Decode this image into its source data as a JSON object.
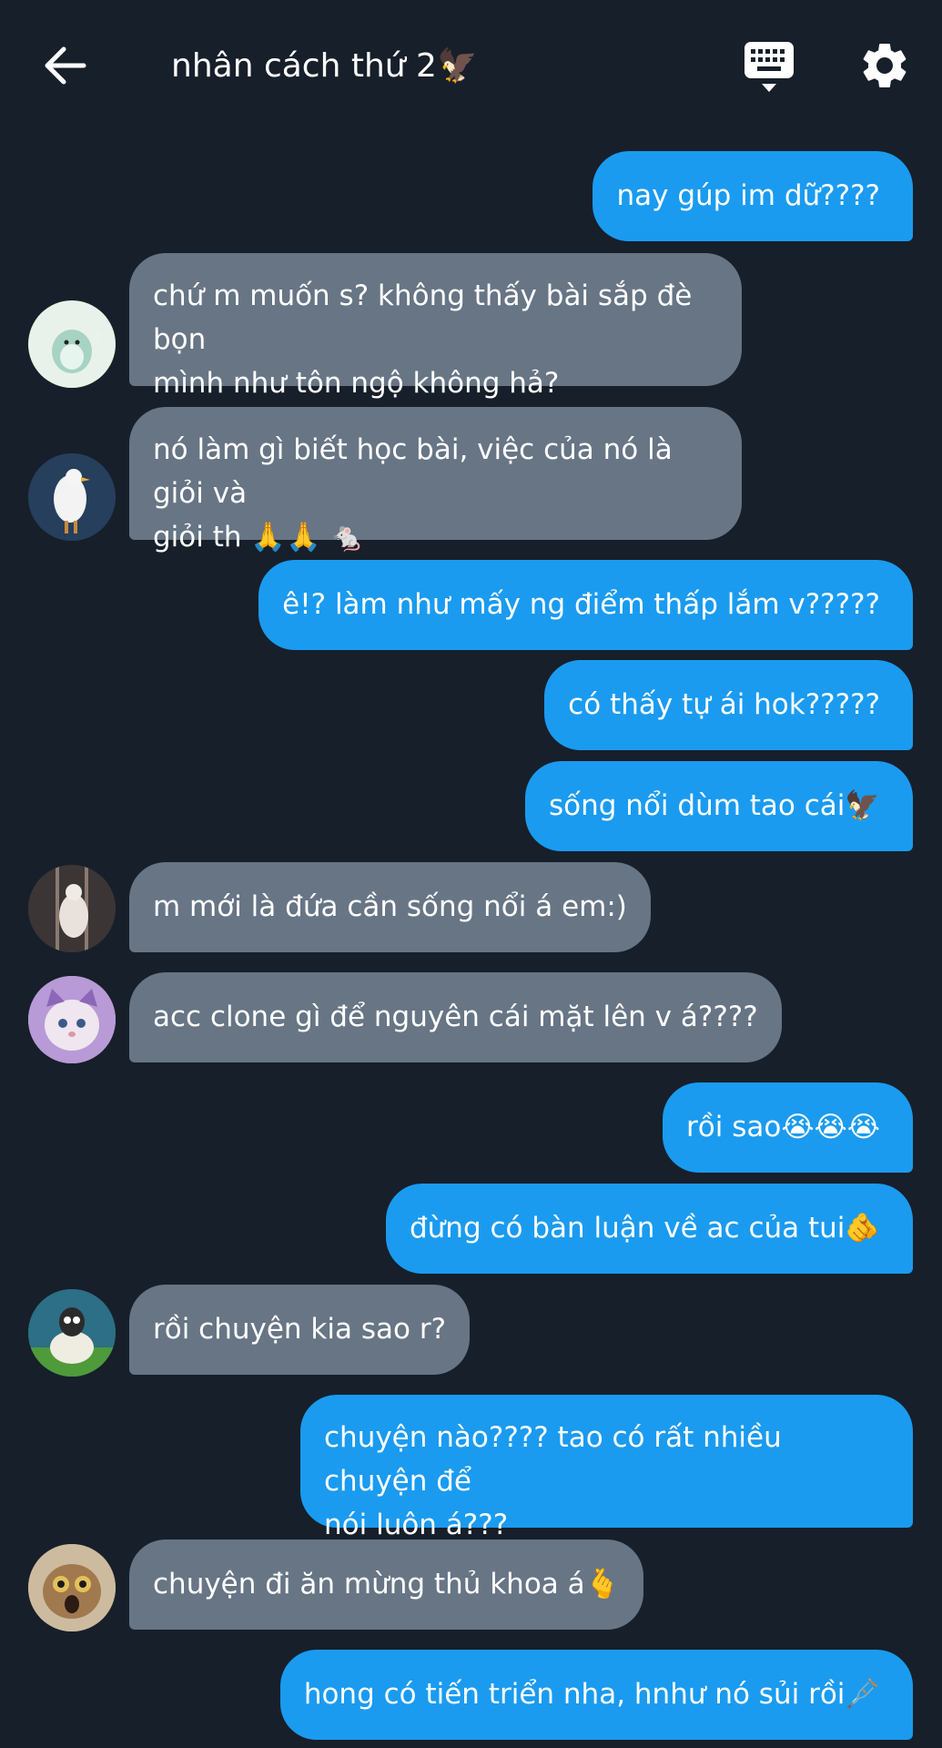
{
  "header": {
    "title": "nhân cách thứ 2🦅",
    "back_icon": "arrow-left-icon",
    "keyboard_icon": "keyboard-icon",
    "settings_icon": "gear-icon"
  },
  "colors": {
    "background": "#171f2a",
    "outgoing_bubble": "#1a9bf0",
    "incoming_bubble": "#677585",
    "text": "#ffffff"
  },
  "messages": [
    {
      "side": "me",
      "text": "nay gúp im dữ????"
    },
    {
      "side": "them",
      "avatar": "avatar-dinosaur",
      "text": "chứ m muốn s? không thấy bài sắp đè bọn\nmình như tôn ngộ không hả?"
    },
    {
      "side": "them",
      "avatar": "avatar-seagull",
      "text": "nó làm gì biết học bài, việc của nó là giỏi và\ngiỏi th 🙏🙏 🐁"
    },
    {
      "side": "me",
      "text": "ê!? làm như mấy ng điểm thấp lắm v?????"
    },
    {
      "side": "me",
      "text": "có thấy tự ái hok?????"
    },
    {
      "side": "me",
      "text": "sống nổi dùm tao cái🦅"
    },
    {
      "side": "them",
      "avatar": "avatar-rat",
      "text": "m mới là đứa cần sống nổi á em:)"
    },
    {
      "side": "them",
      "avatar": "avatar-cat-purple",
      "text": "acc clone gì để nguyên cái mặt lên v á????"
    },
    {
      "side": "me",
      "text": "rồi sao😭😭😭"
    },
    {
      "side": "me",
      "text": "đừng có bàn luận về ac của tui🫵"
    },
    {
      "side": "them",
      "avatar": "avatar-sheep",
      "text": "rồi chuyện kia sao r?"
    },
    {
      "side": "me",
      "text": "chuyện nào???? tao có rất nhiều chuyện để\nnói luôn á???"
    },
    {
      "side": "them",
      "avatar": "avatar-cat-face",
      "text": "chuyện đi ăn mừng thủ khoa á🫰"
    },
    {
      "side": "me",
      "text": "hong có tiến triển nha, hnhư nó sủi rồi🩼"
    }
  ]
}
